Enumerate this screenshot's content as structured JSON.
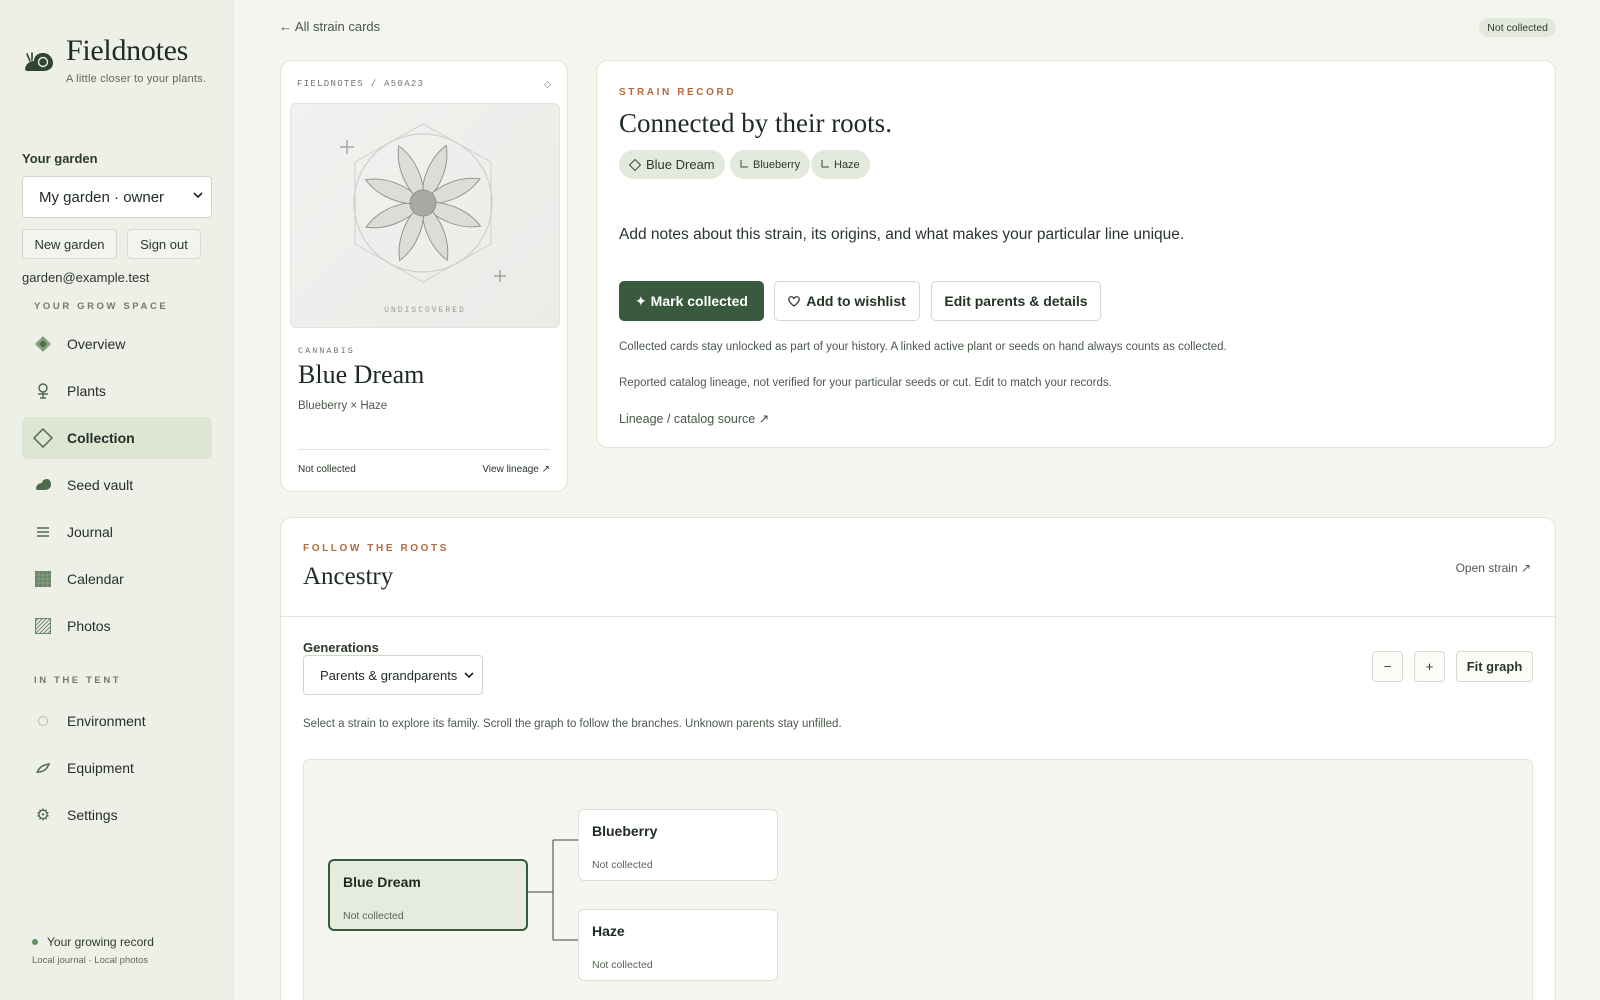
{
  "brand": {
    "name": "Fieldnotes",
    "tagline": "A little closer to your plants."
  },
  "sidebar": {
    "garden_label": "Your garden",
    "garden_select": "My garden · owner",
    "new_garden": "New garden",
    "sign_out": "Sign out",
    "email": "garden@example.test",
    "section_grow": "YOUR GROW SPACE",
    "section_tent": "IN THE TENT",
    "items": [
      {
        "label": "Overview",
        "icon": "diamond-icon"
      },
      {
        "label": "Plants",
        "icon": "plant-icon"
      },
      {
        "label": "Collection",
        "icon": "diamond-outline-icon",
        "active": true
      },
      {
        "label": "Seed vault",
        "icon": "seed-icon"
      },
      {
        "label": "Journal",
        "icon": "lines-icon"
      },
      {
        "label": "Calendar",
        "icon": "grid-icon"
      },
      {
        "label": "Photos",
        "icon": "hatch-icon"
      },
      {
        "label": "Environment",
        "icon": "circle-icon"
      },
      {
        "label": "Equipment",
        "icon": "leaf-icon"
      },
      {
        "label": "Settings",
        "icon": "gear-icon"
      }
    ],
    "record_title": "Your growing record",
    "record_sub": "Local journal · Local photos"
  },
  "topbar": {
    "back_link": "← All strain cards",
    "status": "Not collected"
  },
  "card": {
    "id_line": "FIELDNOTES / A50A23",
    "diamond": "◇",
    "undiscovered": "UNDISCOVERED",
    "kind": "CANNABIS",
    "name": "Blue Dream",
    "lineage": "Blueberry × Haze",
    "status": "Not collected",
    "view_lineage": "View lineage ↗"
  },
  "record": {
    "eyebrow": "STRAIN RECORD",
    "title": "Connected by their roots.",
    "chips": [
      "Blue Dream",
      "Blueberry",
      "Haze"
    ],
    "description": "Add notes about this strain, its origins, and what makes your particular line unique.",
    "mark_collected": "✦ Mark collected",
    "add_wishlist": "Add to wishlist",
    "edit_parents": "Edit parents & details",
    "note1": "Collected cards stay unlocked as part of your history. A linked active plant or seeds on hand always counts as collected.",
    "note2": "Reported catalog lineage, not verified for your particular seeds or cut. Edit to match your records.",
    "source_link": "Lineage / catalog source ↗"
  },
  "ancestry": {
    "eyebrow": "FOLLOW THE ROOTS",
    "title": "Ancestry",
    "open_strain": "Open strain ↗",
    "generations_label": "Generations",
    "generations_value": "Parents & grandparents",
    "zoom_out": "−",
    "zoom_in": "+",
    "fit": "Fit graph",
    "help": "Select a strain to explore its family. Scroll the graph to follow the branches. Unknown parents stay unfilled.",
    "nodes": [
      {
        "name": "Blue Dream",
        "status": "Not collected"
      },
      {
        "name": "Blueberry",
        "status": "Not collected"
      },
      {
        "name": "Haze",
        "status": "Not collected"
      }
    ]
  },
  "colors": {
    "accent": "#3a5a40",
    "eyebrow": "#b26a3e",
    "background": "#f4f5ef"
  }
}
